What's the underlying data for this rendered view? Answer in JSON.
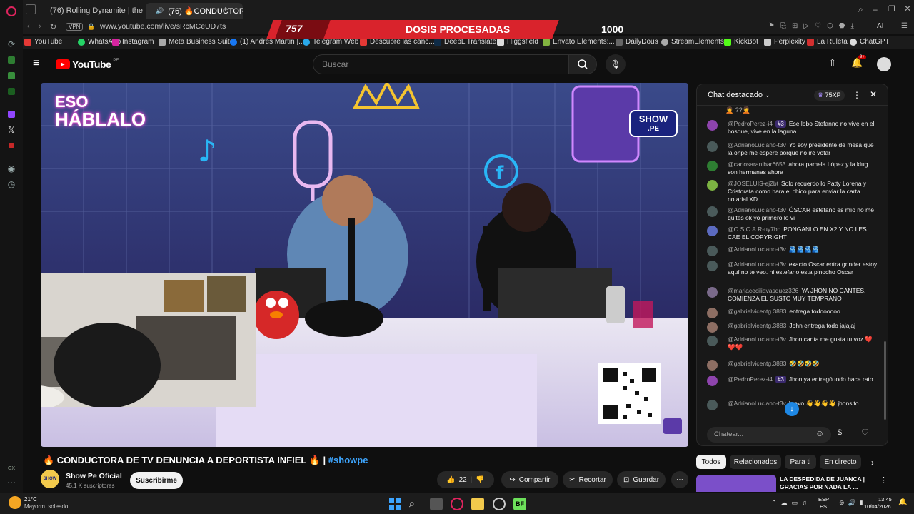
{
  "browser": {
    "tabs": [
      {
        "label": "(76) Rolling Dynamite | the",
        "active": false
      },
      {
        "label": "(76) 🔥CONDUCTOR/",
        "active": true
      }
    ],
    "vpn_label": "VPN",
    "url": "www.youtube.com/live/sRcMCeUD7ts",
    "ai_label": "AI",
    "bookmarks": [
      "YouTube",
      "WhatsApp",
      "Instagram",
      "Meta Business Suite",
      "(1) Andrés Martin |...",
      "Telegram Web",
      "Descubre las canc...",
      "DeepL Translate",
      "Higgsfield",
      "Envato Elements:...",
      "DailyDous",
      "StreamElements",
      "KickBot",
      "Perplexity",
      "La Ruleta",
      "ChatGPT"
    ],
    "left_rail_label": "GX"
  },
  "overlay": {
    "left_number": "757",
    "title": "DOSIS PROCESADAS",
    "right_number": "1000"
  },
  "youtube": {
    "logo_text": "YouTube",
    "logo_region": "PE",
    "search_placeholder": "Buscar",
    "notification_count": "9+"
  },
  "video": {
    "studio_sign_1": "ESO",
    "studio_sign_2": "HÁBLALO",
    "brand_badge_1": "SHOW",
    "brand_badge_2": ".PE",
    "title_prefix": "🔥 CONDUCTORA DE TV DENUNCIA A DEPORTISTA INFIEL 🔥 | ",
    "hashtag": "#showpe",
    "channel_name": "Show Pe Oficial",
    "subscribers": "45,1 K suscriptores",
    "subscribe_label": "Suscribirme",
    "likes": "22",
    "share_label": "Compartir",
    "clip_label": "Recortar",
    "save_label": "Guardar"
  },
  "chat": {
    "header": "Chat destacado",
    "xp": "75XP",
    "input_placeholder": "Chatear...",
    "messages": [
      {
        "author": "@PedroPerez-i4",
        "badge": "#3",
        "text": "Ese lobo Stefanno no vive en el bosque, vive en la laguna",
        "color": "#8e44ad"
      },
      {
        "author": "@AdrianoLuciano-t3v",
        "badge": "",
        "text": "Yo soy presidente de mesa que la onpe me espere porque no iré votar",
        "color": "#4a5a5a"
      },
      {
        "author": "@carlosaranibar6653",
        "badge": "",
        "text": "ahora pamela López y la klug son hermanas ahora",
        "color": "#2e7d32"
      },
      {
        "author": "@JOSELUIS-ej2bt",
        "badge": "",
        "text": "Solo recuerdo lo Patty Lorena y Cristorata como hara el chico para enviar la carta notarial XD",
        "color": "#7cb342"
      },
      {
        "author": "@AdrianoLuciano-t3v",
        "badge": "",
        "text": "ÓSCAR estefano es mío no me quites ok yo primero lo vi",
        "color": "#4a5a5a"
      },
      {
        "author": "@O.S.C.A.R-uy7bo",
        "badge": "",
        "text": "PONGANLO EN X2 Y NO LES CAE EL COPYRIGHT",
        "color": "#5c6bc0"
      },
      {
        "author": "@AdrianoLuciano-t3v",
        "badge": "",
        "text": "🫂🫂🫂🫂",
        "color": "#4a5a5a"
      },
      {
        "author": "@AdrianoLuciano-t3v",
        "badge": "",
        "text": "exacto Oscar entra grinder estoy aquí no te veo. ni estefano esta pinocho Oscar",
        "color": "#4a5a5a"
      },
      {
        "author": "@mariaceciliavasquez326",
        "badge": "",
        "text": "YA JHON NO CANTES, COMIENZA EL SUSTO MUY TEMPRANO",
        "color": "#7a6a8a"
      },
      {
        "author": "@gabrielvicentg.3883",
        "badge": "",
        "text": "entrega todoooooo",
        "color": "#8d6e63"
      },
      {
        "author": "@gabrielvicentg.3883",
        "badge": "",
        "text": "John entrega todo jajajaj",
        "color": "#8d6e63"
      },
      {
        "author": "@AdrianoLuciano-t3v",
        "badge": "",
        "text": "Jhon canta me gusta tu voz ❤️❤️❤️",
        "color": "#4a5a5a"
      },
      {
        "author": "@gabrielvicentg.3883",
        "badge": "",
        "text": "🤣🤣🤣🤣",
        "color": "#8d6e63"
      },
      {
        "author": "@PedroPerez-i4",
        "badge": "#3",
        "text": "Jhon ya entregó todo hace rato",
        "color": "#8e44ad"
      },
      {
        "author": "@AdrianoLuciano-t3v",
        "badge": "",
        "text": "bravo 👋👋👋👋 jhonsito",
        "color": "#4a5a5a"
      }
    ]
  },
  "suggestions": {
    "chips": [
      "Todos",
      "Relacionados",
      "Para ti",
      "En directo"
    ],
    "next_title": "LA DESPEDIDA DE JUANCA | GRACIAS POR NADA LA ..."
  },
  "taskbar": {
    "temperature": "21°C",
    "weather": "Mayorm. soleado",
    "lang_1": "ESP",
    "lang_2": "ES",
    "time": "13:45",
    "date": "10/04/2026"
  }
}
